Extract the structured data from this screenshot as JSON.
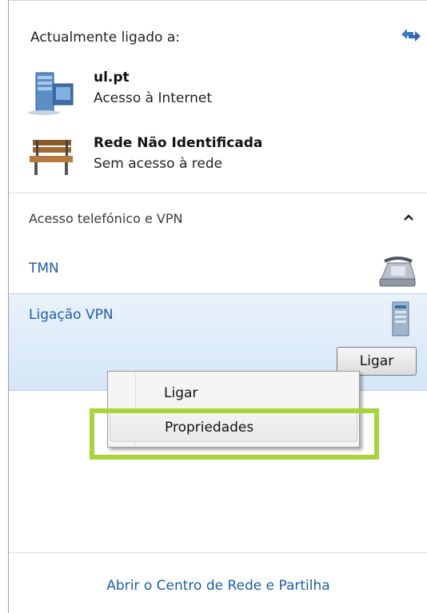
{
  "connected": {
    "header": "Actualmente ligado a:",
    "networks": [
      {
        "name": "ul.pt",
        "status": "Acesso à Internet",
        "icon": "server-network-icon"
      },
      {
        "name": "Rede Não Identificada",
        "status": "Sem acesso à rede",
        "icon": "park-bench-icon"
      }
    ]
  },
  "dialup": {
    "header": "Acesso telefónico e VPN",
    "connections": [
      {
        "name": "TMN",
        "icon": "phone-modem-icon"
      },
      {
        "name": "Ligação VPN",
        "icon": "vpn-server-icon",
        "button": "Ligar",
        "selected": true
      }
    ]
  },
  "context_menu": {
    "items": [
      "Ligar",
      "Propriedades"
    ],
    "highlighted": "Propriedades"
  },
  "footer": {
    "link": "Abrir o Centro de Rede e Partilha"
  },
  "colors": {
    "link": "#1e5fa8",
    "highlight": "#a8d33a",
    "selection": "#d5e6f6"
  }
}
